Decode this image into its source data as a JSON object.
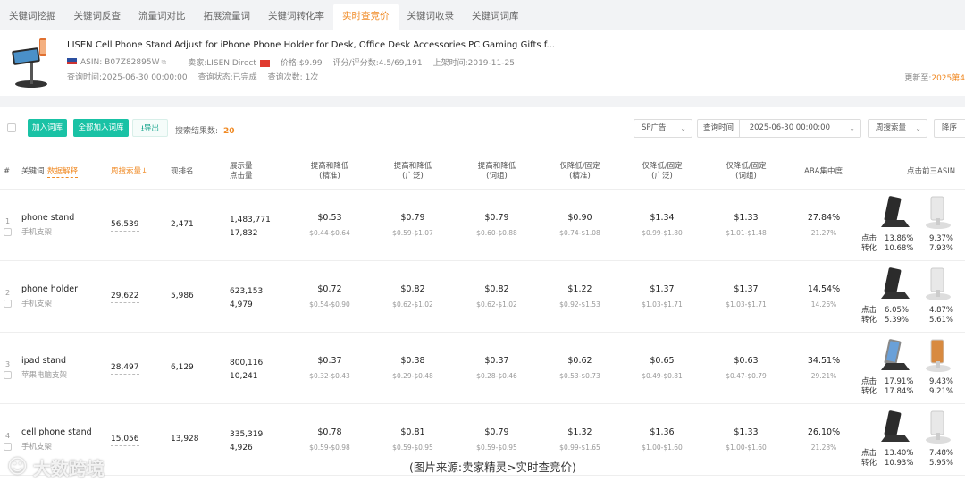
{
  "tabs": [
    "关键词挖掘",
    "关键词反查",
    "流量词对比",
    "拓展流量词",
    "关键词转化率",
    "实时查竞价",
    "关键词收录",
    "关键词词库"
  ],
  "product": {
    "title": "LISEN Cell Phone Stand Adjust for iPhone Phone Holder for Desk, Office Desk Accessories PC Gaming Gifts f...",
    "asin": "ASIN: B07Z82895W",
    "seller": "卖家:LISEN Direct",
    "price": "价格:$9.99",
    "rating": "评分/评分数:4.5/69,191",
    "listed": "上架时间:2019-11-25",
    "query_time": "查询时间:2025-06-30 00:00:00",
    "query_status": "查询状态:已完成",
    "query_count": "查询次数: 1次",
    "update_label": "更新至:",
    "update_value": "2025第4"
  },
  "toolbar": {
    "add_label": "加入词库",
    "add_all_label": "全部加入词库",
    "export_label": "导出",
    "result_label": "搜索结果数:",
    "result_count": "20",
    "ad_type": "SP广告",
    "query_time_label": "查询时间",
    "query_time_value": "2025-06-30 00:00:00",
    "sort_field": "周搜索量",
    "sort_order": "降序"
  },
  "headers": {
    "idx": "#",
    "keyword": "关键词",
    "data_explain": "数据解释",
    "weekly": "周搜索量↓",
    "rank": "现排名",
    "impressions1": "展示量",
    "impressions2": "点击量",
    "c1a": "提高和降低",
    "c1b": "(精准)",
    "c2a": "提高和降低",
    "c2b": "(广泛)",
    "c3a": "提高和降低",
    "c3b": "(词组)",
    "c4a": "仅降低/固定",
    "c4b": "(精准)",
    "c5a": "仅降低/固定",
    "c5b": "(广泛)",
    "c6a": "仅降低/固定",
    "c6b": "(词组)",
    "aba": "ABA集中度",
    "top3": "点击前三ASIN"
  },
  "rows": [
    {
      "idx": "1",
      "kw": "phone stand",
      "kw_cn": "手机支架",
      "weekly": "56,539",
      "rank": "2,471",
      "imp": "1,483,771",
      "clicks": "17,832",
      "p": [
        "$0.53",
        "$0.79",
        "$0.79",
        "$0.90",
        "$1.34",
        "$1.33"
      ],
      "r": [
        "$0.44-$0.64",
        "$0.59-$1.07",
        "$0.60-$0.88",
        "$0.74-$1.08",
        "$0.99-$1.80",
        "$1.01-$1.48"
      ],
      "aba": "27.84%",
      "aba2": "21.27%",
      "click_label": "点击",
      "conv_label": "转化",
      "a1c": "13.86%",
      "a1v": "10.68%",
      "a2c": "9.37%",
      "a2v": "7.93%"
    },
    {
      "idx": "2",
      "kw": "phone holder",
      "kw_cn": "手机支架",
      "weekly": "29,622",
      "rank": "5,986",
      "imp": "623,153",
      "clicks": "4,979",
      "p": [
        "$0.72",
        "$0.82",
        "$0.82",
        "$1.22",
        "$1.37",
        "$1.37"
      ],
      "r": [
        "$0.54-$0.90",
        "$0.62-$1.02",
        "$0.62-$1.02",
        "$0.92-$1.53",
        "$1.03-$1.71",
        "$1.03-$1.71"
      ],
      "aba": "14.54%",
      "aba2": "14.26%",
      "click_label": "点击",
      "conv_label": "转化",
      "a1c": "6.05%",
      "a1v": "5.39%",
      "a2c": "4.87%",
      "a2v": "5.61%"
    },
    {
      "idx": "3",
      "kw": "ipad stand",
      "kw_cn": "苹果电脑支架",
      "weekly": "28,497",
      "rank": "6,129",
      "imp": "800,116",
      "clicks": "10,241",
      "p": [
        "$0.37",
        "$0.38",
        "$0.37",
        "$0.62",
        "$0.65",
        "$0.63"
      ],
      "r": [
        "$0.32-$0.43",
        "$0.29-$0.48",
        "$0.28-$0.46",
        "$0.53-$0.73",
        "$0.49-$0.81",
        "$0.47-$0.79"
      ],
      "aba": "34.51%",
      "aba2": "29.21%",
      "click_label": "点击",
      "conv_label": "转化",
      "a1c": "17.91%",
      "a1v": "17.84%",
      "a2c": "9.43%",
      "a2v": "9.21%"
    },
    {
      "idx": "4",
      "kw": "cell phone stand",
      "kw_cn": "手机支架",
      "weekly": "15,056",
      "rank": "13,928",
      "imp": "335,319",
      "clicks": "4,926",
      "p": [
        "$0.78",
        "$0.81",
        "$0.79",
        "$1.32",
        "$1.36",
        "$1.33"
      ],
      "r": [
        "$0.59-$0.98",
        "$0.59-$0.95",
        "$0.59-$0.95",
        "$0.99-$1.65",
        "$1.00-$1.60",
        "$1.00-$1.60"
      ],
      "aba": "26.10%",
      "aba2": "21.28%",
      "click_label": "点击",
      "conv_label": "转化",
      "a1c": "13.40%",
      "a1v": "10.93%",
      "a2c": "7.48%",
      "a2v": "5.95%"
    }
  ],
  "watermark": "大数跨境",
  "caption": "(图片来源:卖家精灵>实时查竞价)",
  "colors": {
    "accent": "#f08a24",
    "primary": "#19c2a5"
  }
}
